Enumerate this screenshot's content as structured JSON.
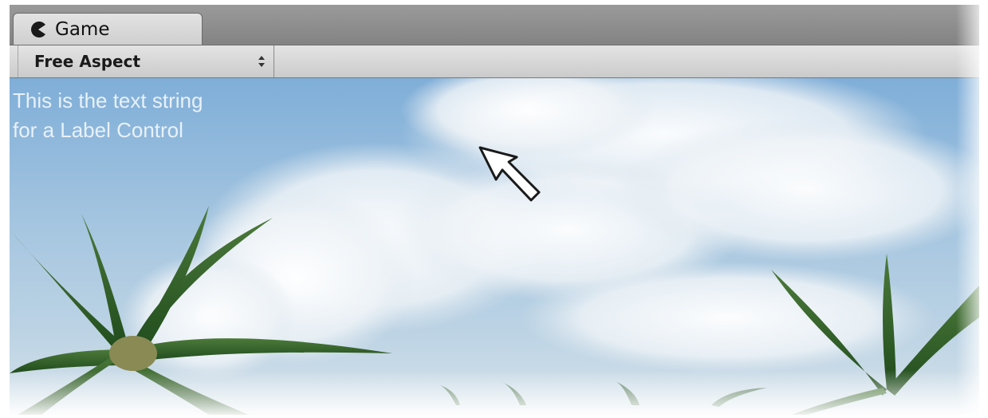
{
  "tab": {
    "title": "Game",
    "icon": "pacman-game-icon"
  },
  "toolbar": {
    "aspect_value": "Free Aspect",
    "aspect_icon": "up-down-arrows-icon"
  },
  "viewport": {
    "label_text": "This is the text string for a Label Control",
    "cursor_icon": "mouse-cursor-icon"
  },
  "colors": {
    "tab_bar": "#8c8c8c",
    "toolbar": "#d8d8d8",
    "sky": "#8db8dc",
    "label_text": "#e8f1f8"
  }
}
